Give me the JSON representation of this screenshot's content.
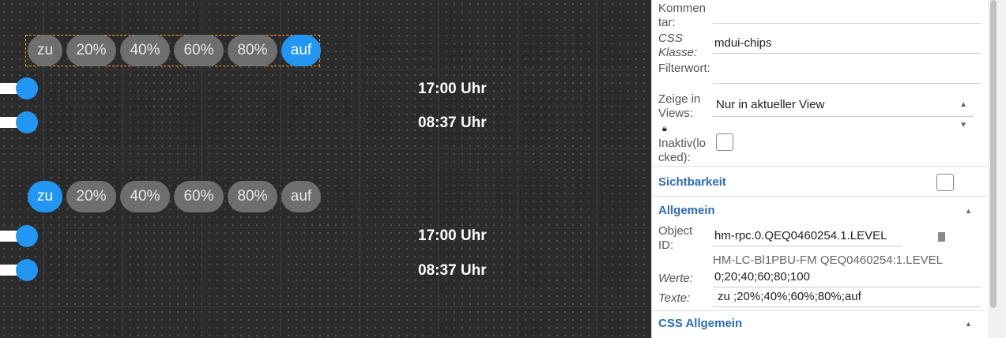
{
  "canvas": {
    "chips_top": [
      "zu",
      "20%",
      "40%",
      "60%",
      "80%",
      "auf"
    ],
    "chips_bottom": [
      "zu",
      "20%",
      "40%",
      "60%",
      "80%",
      "auf"
    ],
    "times": [
      "17:00 Uhr",
      "08:37 Uhr",
      "17:00 Uhr",
      "08:37 Uhr"
    ],
    "colors": {
      "accent": "#2196f3",
      "chip": "#6e6e6e",
      "selection": "#f29a1f"
    }
  },
  "panel": {
    "kommentar_label": "Kommen\ntar:",
    "kommentar_value": "",
    "css_klasse_label": "CSS Klasse:",
    "css_klasse_value": "mdui-chips",
    "filterwort_label": "Filterwort:",
    "filterwort_value": "",
    "zeige_label": "Zeige in Views:",
    "zeige_value": "Nur in aktueller View",
    "inaktiv_label": "Inaktiv(locked):",
    "sichtbarkeit_title": "Sichtbarkeit",
    "allgemein_title": "Allgemein",
    "object_id_label": "Object ID:",
    "object_id_value": "hm-rpc.0.QEQ0460254.1.LEVEL",
    "object_id_hint": "HM-LC-Bl1PBU-FM QEQ0460254:1.LEVEL",
    "werte_label": "Werte:",
    "werte_value": "0;20;40;60;80;100",
    "texte_label": "Texte:",
    "texte_value": "zu ;20%;40%;60%;80%;auf",
    "css_allgemein_title": "CSS Allgemein"
  }
}
